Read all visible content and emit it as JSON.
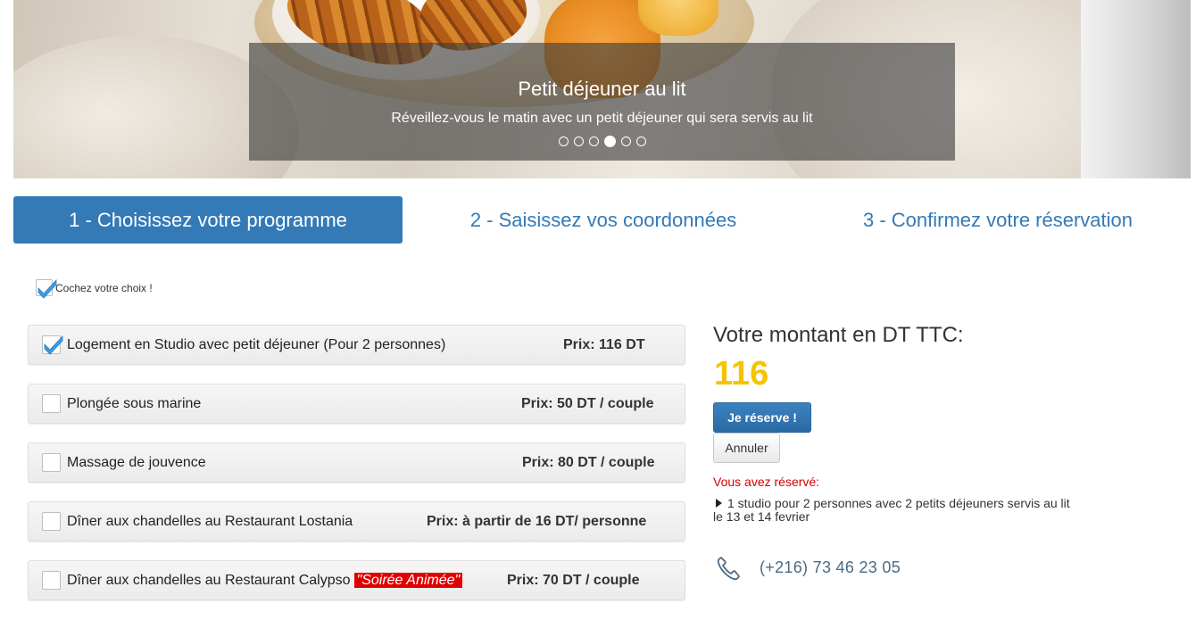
{
  "banner": {
    "title": "Petit déjeuner au lit",
    "subtitle": "Réveillez-vous le matin avec un petit déjeuner qui sera servis au lit",
    "slides_total": 6,
    "active_slide": 4
  },
  "steps": [
    {
      "label": "1 - Choisissez votre programme",
      "active": true
    },
    {
      "label": "2 - Saisissez vos coordonnées",
      "active": false
    },
    {
      "label": "3 - Confirmez votre réservation",
      "active": false
    }
  ],
  "hint": {
    "label": "Cochez votre choix !"
  },
  "options": [
    {
      "name": "Logement en Studio avec petit déjeuner (Pour 2 personnes)",
      "price": "Prix: 116 DT",
      "checked": true
    },
    {
      "name": "Plongée sous marine",
      "price": "Prix: 50 DT / couple",
      "checked": false
    },
    {
      "name": "Massage de jouvence",
      "price": "Prix: 80 DT / couple",
      "checked": false
    },
    {
      "name": "Dîner aux chandelles au Restaurant Lostania",
      "price": "Prix: à partir de 16 DT/ personne",
      "checked": false
    },
    {
      "name": "Dîner aux chandelles au Restaurant Calypso",
      "badge": "\"Soirée Animée\"",
      "price": "Prix: 70 DT / couple",
      "checked": false
    }
  ],
  "summary": {
    "title": "Votre montant en DT TTC:",
    "amount": "116",
    "reserve_button": "Je réserve !",
    "cancel_button": "Annuler",
    "reserved_title": "Vous avez réservé:",
    "reserved_items": [
      "1 studio pour 2 personnes avec 2 petits déjeuners servis au lit le 13 et 14 fevrier"
    ],
    "phone": "(+216) 73 46 23 05"
  },
  "colors": {
    "primary": "#337ab7",
    "amount": "#f5c400",
    "alert": "#d60000",
    "badge_bg": "#e00000"
  }
}
